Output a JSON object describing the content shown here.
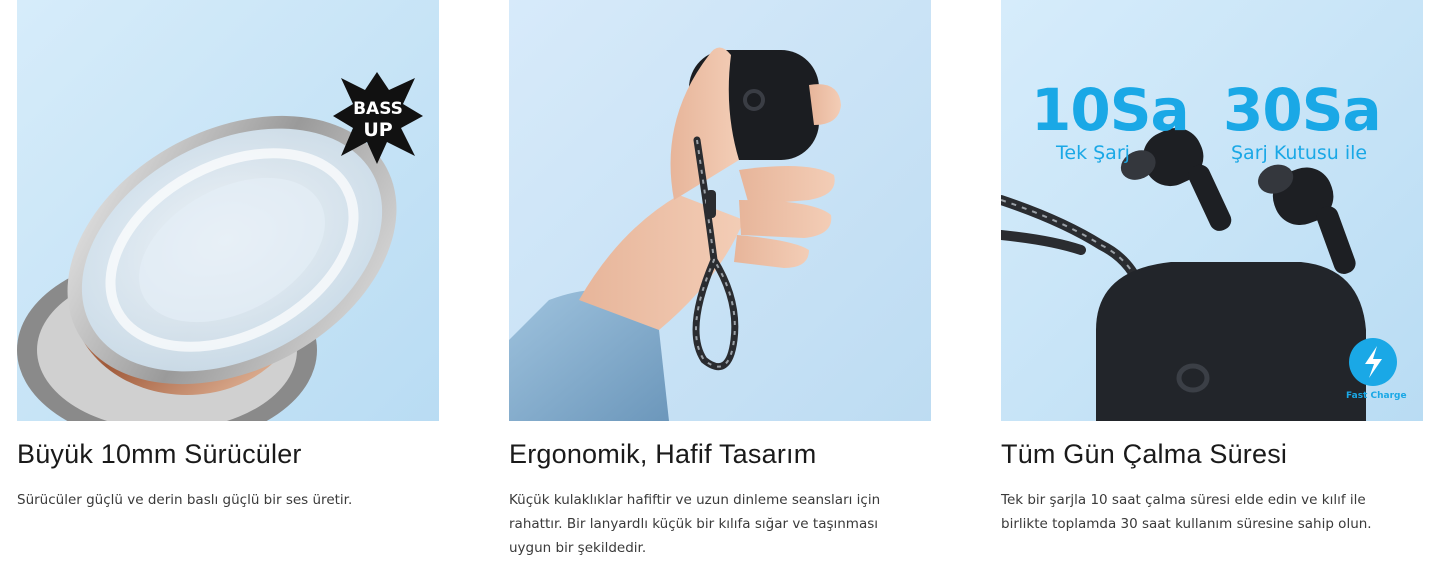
{
  "cards": [
    {
      "title": "Büyük 10mm Sürücüler",
      "description": "Sürücüler güçlü ve derin baslı güçlü bir ses üretir.",
      "badge": [
        "BASS",
        "UP"
      ]
    },
    {
      "title": "Ergonomik, Hafif Tasarım",
      "description": "Küçük kulaklıklar hafiftir ve uzun dinleme seansları için rahattır. Bir lanyardlı küçük bir kılıfa sığar ve taşınması uygun bir şekildedir."
    },
    {
      "title": "Tüm Gün Çalma Süresi",
      "description": "Tek bir şarjla 10 saat çalma süresi elde edin ve kılıf ile birlikte toplamda 30 saat kullanım süresine sahip olun.",
      "stat1": {
        "value": "10Sa",
        "label": "Tek Şarj"
      },
      "stat2": {
        "value": "30Sa",
        "label": "Şarj Kutusu ile"
      },
      "fast_charge": "Fast Charge"
    }
  ],
  "colors": {
    "accent": "#1aa8e6",
    "sky": "#cfe7f7",
    "text": "#1a1a1a"
  }
}
